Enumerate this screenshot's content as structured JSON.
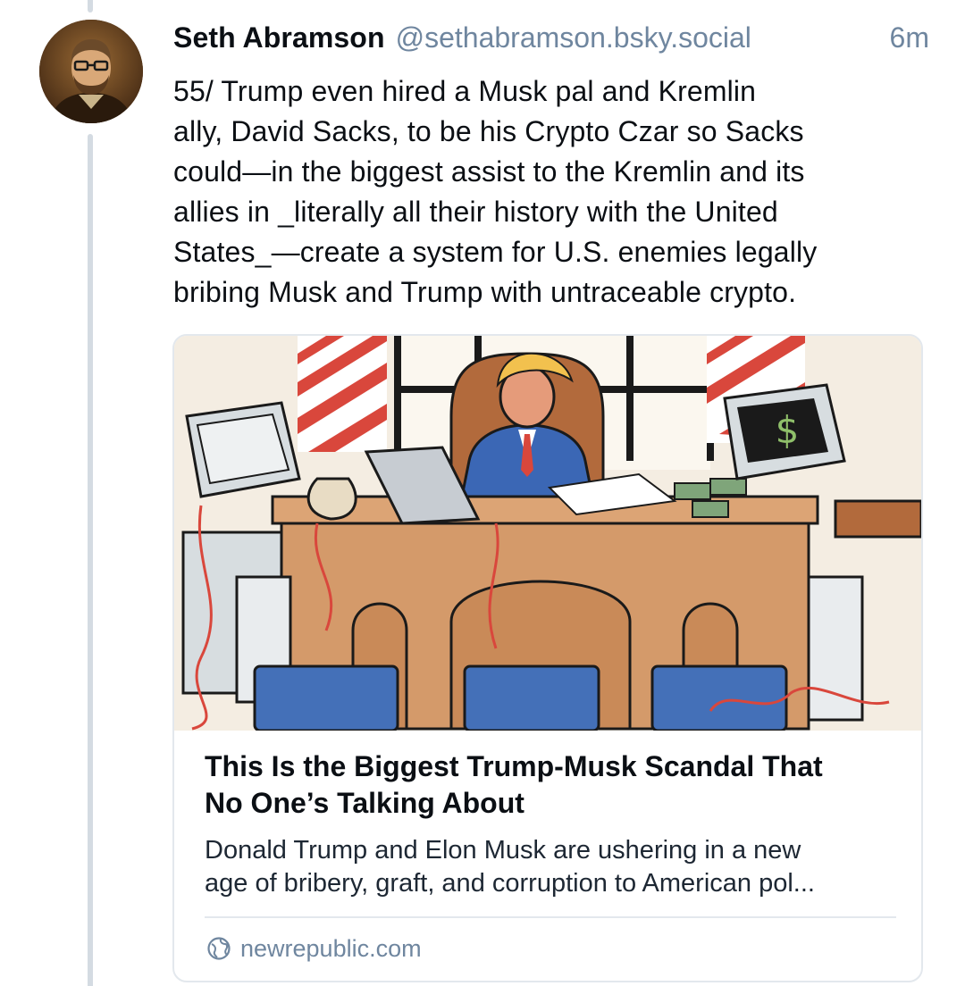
{
  "post": {
    "author_name": "Seth Abramson",
    "author_handle": "@sethabramson.bsky.social",
    "time": "6m",
    "text": "55/ Trump even hired a Musk pal and Kremlin\nally, David Sacks, to be his Crypto Czar so Sacks\ncould—in the biggest assist to the Kremlin and its\nallies in _literally all their history with the United\nStates_—create a system for U.S. enemies legally\nbribing Musk and Trump with untraceable crypto.",
    "avatar_icon": "author-avatar"
  },
  "link_card": {
    "title": "This Is the Biggest Trump-Musk Scandal That\nNo One’s Talking About",
    "description": "Donald Trump and Elon Musk are ushering in a new\nage of bribery, graft, and corruption to American pol...",
    "domain": "newrepublic.com",
    "domain_icon": "globe-icon",
    "image_desc": "illustration-president-at-desk"
  },
  "colors": {
    "text": "#0b0f14",
    "muted": "#6f869f",
    "thread_line": "#d4dbe2",
    "card_border": "#e3e8ed"
  }
}
